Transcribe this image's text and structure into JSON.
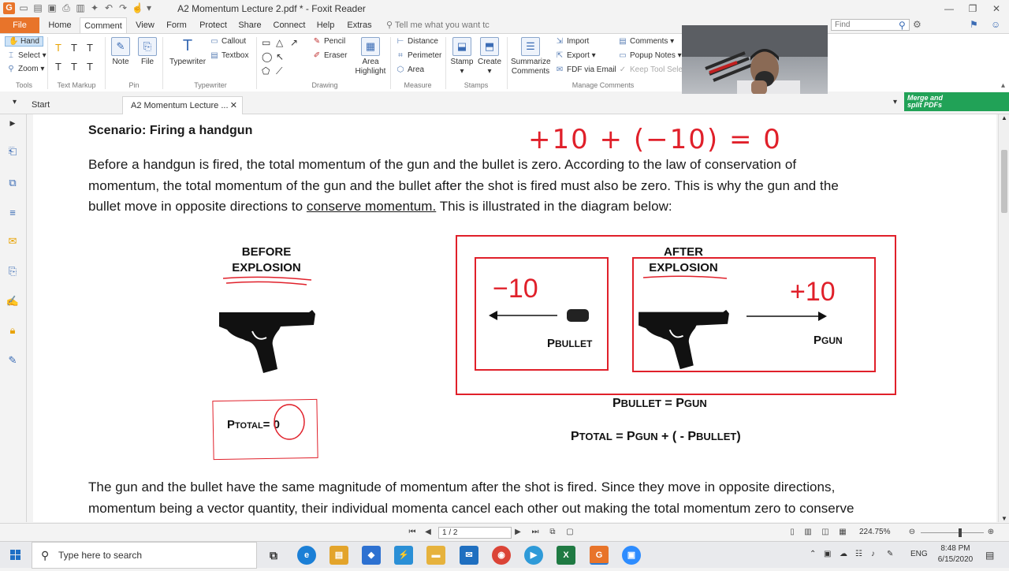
{
  "app": {
    "window_title": "A2 Momentum Lecture 2.pdf * - Foxit Reader",
    "logo_letter": "G"
  },
  "tabs": [
    "File",
    "Home",
    "Comment",
    "View",
    "Form",
    "Protect",
    "Share",
    "Connect",
    "Help",
    "Extras"
  ],
  "tell_me": "Tell me what you want tc",
  "find_placeholder": "Find",
  "ribbon": {
    "tools": {
      "hand": "Hand",
      "select": "Select",
      "zoom": "Zoom",
      "label": "Tools"
    },
    "text_markup": {
      "label": "Text Markup"
    },
    "pin": {
      "note": "Note",
      "file": "File",
      "label": "Pin"
    },
    "typewriter": {
      "typewriter": "Typewriter",
      "callout": "Callout",
      "textbox": "Textbox",
      "label": "Typewriter"
    },
    "drawing": {
      "pencil": "Pencil",
      "eraser": "Eraser",
      "area_highlight_1": "Area",
      "area_highlight_2": "Highlight",
      "label": "Drawing"
    },
    "measure": {
      "distance": "Distance",
      "perimeter": "Perimeter",
      "area": "Area",
      "label": "Measure"
    },
    "stamps": {
      "stamp": "Stamp",
      "create": "Create",
      "label": "Stamps"
    },
    "comments": {
      "summarize_1": "Summarize",
      "summarize_2": "Comments",
      "import": "Import",
      "export": "Export",
      "fdf": "FDF via Email",
      "comments": "Comments",
      "popup": "Popup Notes",
      "keep": "Keep Tool Selec",
      "label": "Manage Comments"
    }
  },
  "merge_banner": {
    "line1": "Merge and",
    "line2": "split PDFs"
  },
  "doc_tabs": [
    "Start",
    "A2 Momentum Lecture ..."
  ],
  "page": {
    "heading": "Scenario: Firing a handgun",
    "para1_line1": "Before a handgun is fired, the total momentum of the gun and the bullet is zero. According to the law of conservation of",
    "para1_line2": "momentum, the total momentum of the gun and the bullet after the shot is fired must also be zero. This is why the gun and the",
    "para1_line3a": "bullet move in opposite directions to ",
    "para1_line3_link": "conserve momentum.",
    "para1_line3b": " This is illustrated in the diagram below:",
    "handwritten_equation": "+10 + (−10) = 0",
    "before_label_1": "BEFORE",
    "before_label_2": "EXPLOSION",
    "after_label_1": "AFTER",
    "after_label_2": "EXPLOSION",
    "hand_minus10": "−10",
    "hand_plus10": "+10",
    "p_bullet": "P",
    "p_bullet_sub": "BULLET",
    "p_gun": "P",
    "p_gun_sub": "GUN",
    "p_total": "P",
    "p_total_sub": "TOTAL",
    "p_total_eq": "= 0",
    "eq1": "P",
    "eq1_sub1": "BULLET",
    "eq1_mid": " = P",
    "eq1_sub2": "GUN",
    "eq2_p": "P",
    "eq2_sub1": "TOTAL",
    "eq2_mid": " = P",
    "eq2_sub2": "GUN",
    "eq2_mid2": " + ( - P",
    "eq2_sub3": "BULLET",
    "eq2_end": ")",
    "para2_line1": "The gun and the bullet have the same magnitude of momentum after the shot is fired. Since they move in opposite directions,",
    "para2_line2": "momentum being a vector quantity, their individual momenta cancel each other out making the total momentum zero to conserve"
  },
  "status": {
    "page_indicator": "1 / 2",
    "zoom": "224.75%"
  },
  "taskbar": {
    "search_placeholder": "Type here to search",
    "language": "ENG",
    "time": "8:48 PM",
    "date": "6/15/2020"
  },
  "colors": {
    "accent_orange": "#e8742a",
    "annotation_red": "#e0202a",
    "merge_green": "#21a257"
  }
}
